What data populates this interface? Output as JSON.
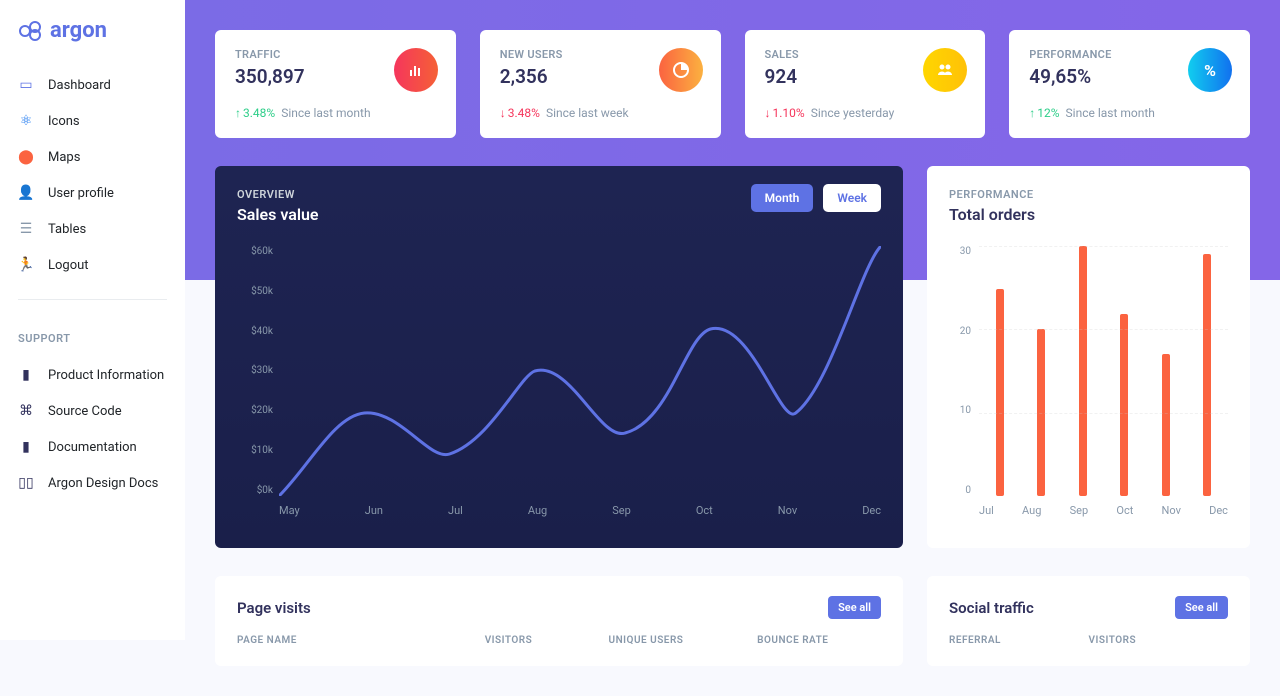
{
  "brand": "argon",
  "sidebar": {
    "items": [
      {
        "label": "Dashboard",
        "icon": "tv",
        "color": "#5e72e4"
      },
      {
        "label": "Icons",
        "icon": "atom",
        "color": "#1171ef"
      },
      {
        "label": "Maps",
        "icon": "pin",
        "color": "#fb6340"
      },
      {
        "label": "User profile",
        "icon": "user",
        "color": "#ffd600"
      },
      {
        "label": "Tables",
        "icon": "list",
        "color": "#8898aa"
      },
      {
        "label": "Logout",
        "icon": "run",
        "color": "#f5365c"
      }
    ],
    "support_label": "SUPPORT",
    "support": [
      {
        "label": "Product Information"
      },
      {
        "label": "Source Code"
      },
      {
        "label": "Documentation"
      },
      {
        "label": "Argon Design Docs"
      }
    ]
  },
  "cards": [
    {
      "title": "TRAFFIC",
      "value": "350,897",
      "delta": "3.48%",
      "dir": "up",
      "since": "Since last month",
      "circ": "c-red",
      "icon": "chart"
    },
    {
      "title": "NEW USERS",
      "value": "2,356",
      "delta": "3.48%",
      "dir": "down",
      "since": "Since last week",
      "circ": "c-org",
      "icon": "pie"
    },
    {
      "title": "SALES",
      "value": "924",
      "delta": "1.10%",
      "dir": "down",
      "since": "Since yesterday",
      "circ": "c-yel",
      "icon": "users"
    },
    {
      "title": "PERFORMANCE",
      "value": "49,65%",
      "delta": "12%",
      "dir": "up",
      "since": "Since last month",
      "circ": "c-cyn",
      "icon": "pct"
    }
  ],
  "sales": {
    "sub": "OVERVIEW",
    "title": "Sales value",
    "tabs": {
      "month": "Month",
      "week": "Week"
    },
    "yticks": [
      "$60k",
      "$50k",
      "$40k",
      "$30k",
      "$20k",
      "$10k",
      "$0k"
    ],
    "xticks": [
      "May",
      "Jun",
      "Jul",
      "Aug",
      "Sep",
      "Oct",
      "Nov",
      "Dec"
    ]
  },
  "orders": {
    "sub": "PERFORMANCE",
    "title": "Total orders",
    "yticks": [
      "30",
      "20",
      "10",
      "0"
    ],
    "xticks": [
      "Jul",
      "Aug",
      "Sep",
      "Oct",
      "Nov",
      "Dec"
    ]
  },
  "visits": {
    "title": "Page visits",
    "see": "See all",
    "cols": [
      "PAGE NAME",
      "VISITORS",
      "UNIQUE USERS",
      "BOUNCE RATE"
    ]
  },
  "social": {
    "title": "Social traffic",
    "see": "See all",
    "cols": [
      "REFERRAL",
      "VISITORS"
    ]
  },
  "chart_data": [
    {
      "type": "line",
      "title": "Sales value",
      "categories": [
        "May",
        "Jun",
        "Jul",
        "Aug",
        "Sep",
        "Oct",
        "Nov",
        "Dec"
      ],
      "values": [
        0,
        20,
        10,
        30,
        15,
        40,
        20,
        60
      ],
      "ylabel": "$k",
      "ylim": [
        0,
        60
      ]
    },
    {
      "type": "bar",
      "title": "Total orders",
      "categories": [
        "Jul",
        "Aug",
        "Sep",
        "Oct",
        "Nov",
        "Dec"
      ],
      "values": [
        25,
        20,
        30,
        22,
        17,
        29
      ],
      "ylim": [
        0,
        30
      ]
    }
  ]
}
